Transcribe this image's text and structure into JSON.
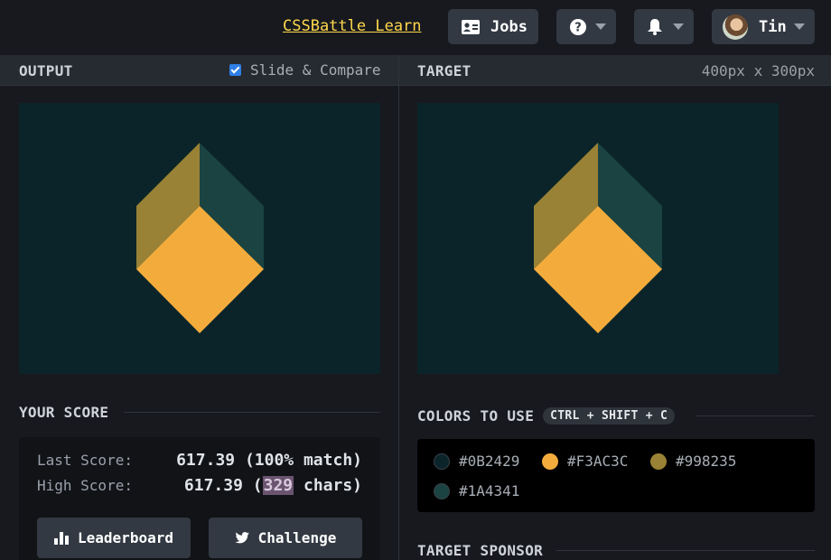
{
  "header": {
    "learn_link": "CSSBattle Learn",
    "jobs_label": "Jobs",
    "user_name": "Tin"
  },
  "output_panel": {
    "title": "OUTPUT",
    "slide_compare_label": "Slide & Compare",
    "slide_compare_checked": true
  },
  "target_panel": {
    "title": "TARGET",
    "dimensions": "400px x 300px"
  },
  "score": {
    "title": "YOUR SCORE",
    "last_label": "Last Score:",
    "last_value": "617.39 (100% match)",
    "high_label": "High Score:",
    "high_value_prefix": "617.39 (",
    "high_chars": "329",
    "high_value_suffix": " chars)",
    "leaderboard_label": "Leaderboard",
    "challenge_label": "Challenge"
  },
  "colors": {
    "title": "COLORS TO USE",
    "shortcut": "CTRL + SHIFT + C",
    "items": [
      {
        "hex": "#0B2429",
        "color": "#0B2429"
      },
      {
        "hex": "#F3AC3C",
        "color": "#F3AC3C"
      },
      {
        "hex": "#998235",
        "color": "#998235"
      },
      {
        "hex": "#1A4341",
        "color": "#1A4341"
      }
    ]
  },
  "sponsor": {
    "title": "TARGET SPONSOR"
  },
  "icons": {
    "jobs": "id-card-icon",
    "help": "question-circle-icon",
    "notifications": "bell-icon",
    "leaderboard": "bar-chart-icon",
    "challenge": "twitter-icon"
  }
}
